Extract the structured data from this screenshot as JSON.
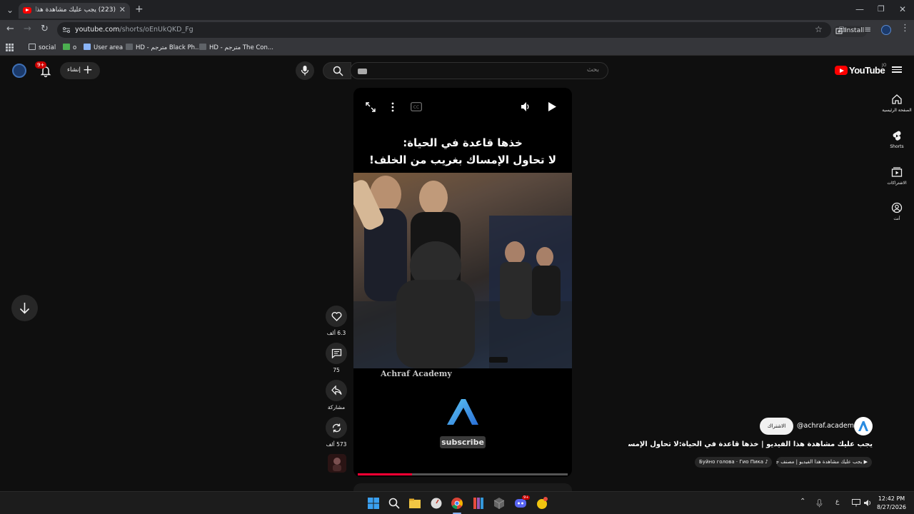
{
  "browser": {
    "tab_title": "(223) يجب عليك مشاهدة هذا الف",
    "tab_close": "✕",
    "new_tab": "+",
    "url_host": "youtube.com",
    "url_path": "/shorts/oEnUkQKD_Fg",
    "install_label": "Install",
    "bookmarks": [
      {
        "label": "social"
      },
      {
        "label": "o"
      },
      {
        "label": "User area"
      },
      {
        "label": "HD - مترجم Black Ph..."
      },
      {
        "label": "HD - مترجم The Con..."
      }
    ]
  },
  "youtube": {
    "logo_text": "YouTube",
    "logo_country": "JO",
    "search_placeholder": "بحث",
    "create_label": "إنشاء",
    "notification_count": "9+",
    "sidebar": [
      {
        "label": "الصفحة الرئيسية",
        "icon": "home-icon"
      },
      {
        "label": "Shorts",
        "icon": "shorts-icon"
      },
      {
        "label": "الاشتراكات",
        "icon": "subscriptions-icon"
      },
      {
        "label": "أنت",
        "icon": "you-icon"
      }
    ]
  },
  "short": {
    "headline_line1": "خذها قاعدة في الحياة:",
    "headline_line2": "لا تحاول الإمساك بغريب من الخلف!",
    "watermark": "Achraf Academy",
    "subscribe_tag": "subscribe",
    "progress": 0.26,
    "likes": "6.3 ألف",
    "comments": "75",
    "share_label": "مشاركة",
    "remix": "573 ألف",
    "channel_handle": "@achraf.academy",
    "subscribe_button": "الاشتراك",
    "title": "يجب عليك مشاهدة هذا الفيديو | خذها قاعدة في الحياة:لا تحاول الإمساك ...",
    "chip_playlist": "يجب عليك مشاهدة هذا الفيديو | مصنف جيهي...",
    "chip_sound": "Буйно голова · Гио Пика"
  },
  "taskbar": {
    "time": "12:42 PM",
    "date": "8/27/2026",
    "lang": "ع",
    "discord_badge": "9+"
  },
  "colors": {
    "accent_red": "#ff0000",
    "progress_red": "#ff0033",
    "page_bg": "#0f0f0f"
  }
}
